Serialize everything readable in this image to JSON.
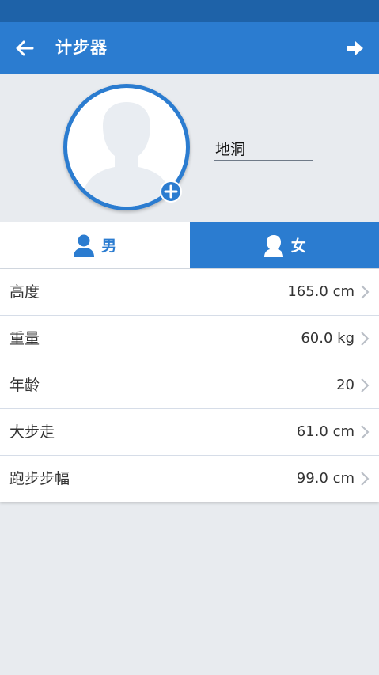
{
  "header": {
    "title": "计步器"
  },
  "profile": {
    "name": "地洞"
  },
  "gender": {
    "male_label": "男",
    "female_label": "女",
    "selected": "female"
  },
  "settings": {
    "items": [
      {
        "label": "高度",
        "value": "165.0 cm"
      },
      {
        "label": "重量",
        "value": "60.0 kg"
      },
      {
        "label": "年龄",
        "value": "20"
      },
      {
        "label": "大步走",
        "value": "61.0 cm"
      },
      {
        "label": "跑步步幅",
        "value": "99.0 cm"
      }
    ]
  },
  "icons": {
    "back": "arrow-left-icon",
    "forward": "arrow-right-icon",
    "add_photo": "plus-icon",
    "male": "male-user-icon",
    "female": "female-user-icon",
    "chevron": "chevron-right-icon"
  },
  "colors": {
    "primary": "#2b7cd0",
    "status_bar": "#1e62a8",
    "background": "#e8ebef"
  }
}
